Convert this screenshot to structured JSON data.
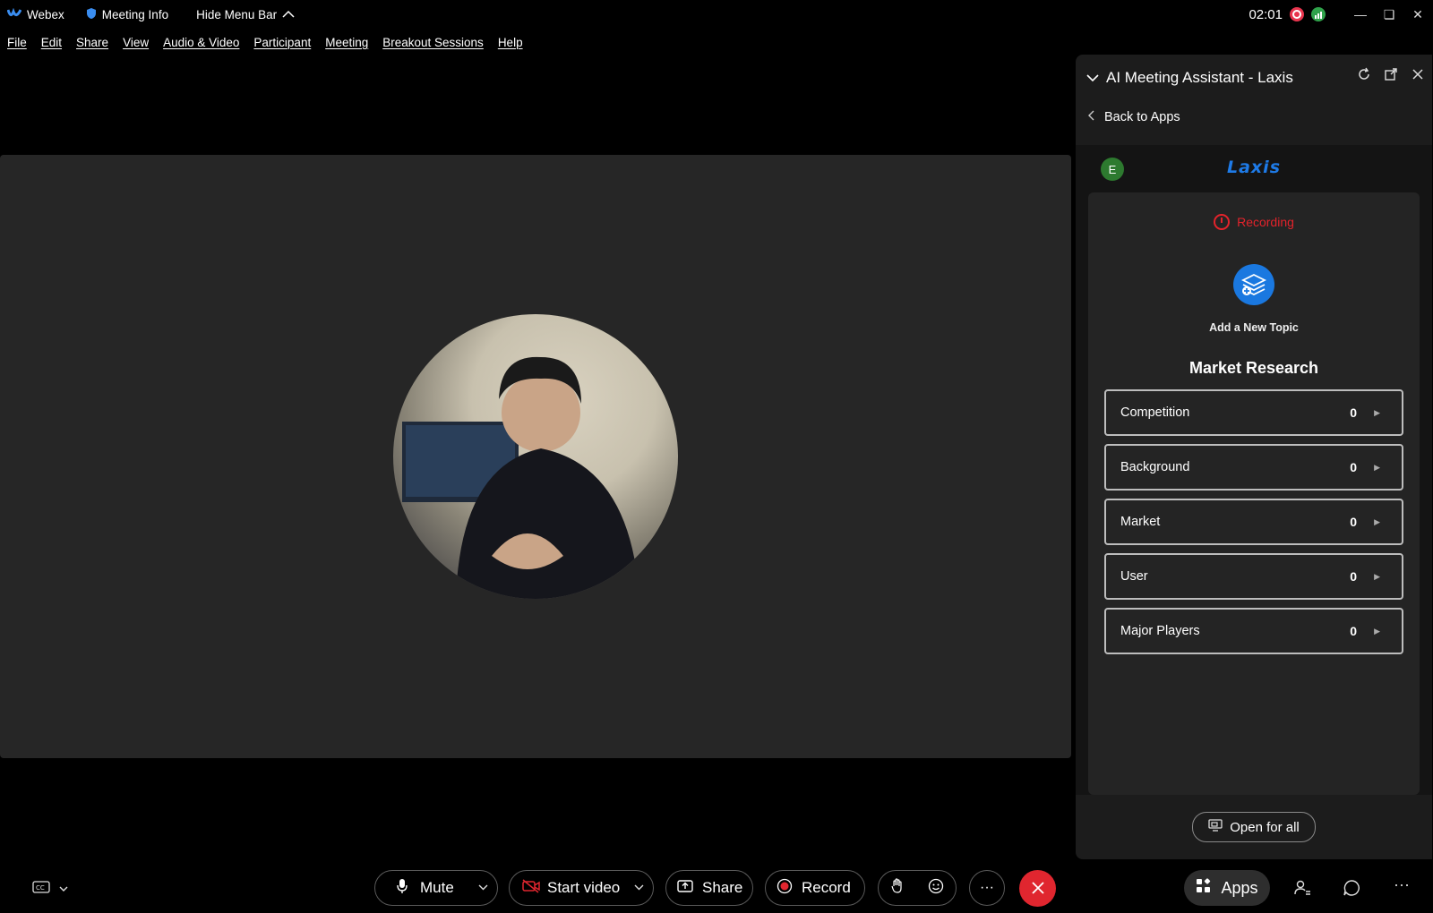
{
  "titlebar": {
    "app_name": "Webex",
    "meeting_info": "Meeting Info",
    "hide_menu_bar": "Hide Menu Bar",
    "clock": "02:01"
  },
  "menu": [
    "File",
    "Edit",
    "Share",
    "View",
    "Audio & Video",
    "Participant",
    "Meeting",
    "Breakout Sessions",
    "Help"
  ],
  "panel": {
    "title": "AI Meeting Assistant - Laxis",
    "back_label": "Back to Apps",
    "user_initial": "E",
    "logo_text": "Laxis",
    "recording_label": "Recording",
    "add_topic_label": "Add a New Topic",
    "section_title": "Market Research",
    "topics": [
      {
        "label": "Competition",
        "count": "0"
      },
      {
        "label": "Background",
        "count": "0"
      },
      {
        "label": "Market",
        "count": "0"
      },
      {
        "label": "User",
        "count": "0"
      },
      {
        "label": "Major Players",
        "count": "0"
      }
    ],
    "open_for_all_label": "Open for all"
  },
  "toolbar": {
    "mute_label": "Mute",
    "start_video_label": "Start video",
    "share_label": "Share",
    "record_label": "Record",
    "apps_label": "Apps",
    "more_label": "···"
  },
  "colors": {
    "accent_blue": "#1a78e0",
    "recording_red": "#e3232b",
    "end_call_red": "#e0262f",
    "stage_bg": "#262626"
  }
}
